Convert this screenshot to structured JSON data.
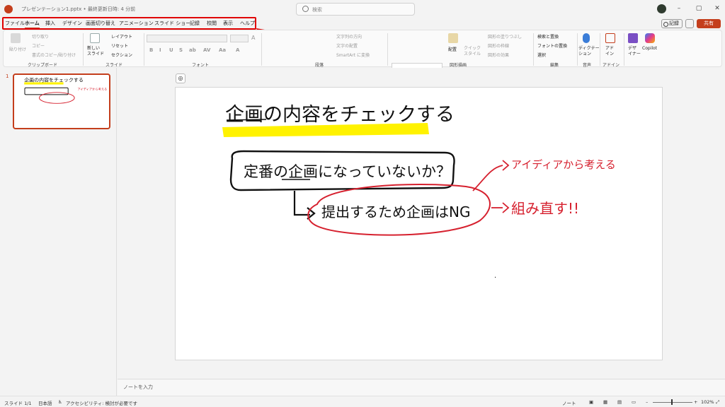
{
  "window": {
    "doc_title": "プレゼンテーション1.pptx • 最終更新日時: 4 分前",
    "search_placeholder": "検索"
  },
  "tabs": [
    "ファイル",
    "ホーム",
    "挿入",
    "デザイン",
    "画面切り替え",
    "アニメーション",
    "スライド ショー",
    "記録",
    "校閲",
    "表示",
    "ヘルプ"
  ],
  "active_tab": "ホーム",
  "header_actions": {
    "record": "記録",
    "share": "共有"
  },
  "ribbon": {
    "clipboard": {
      "paste": "貼り付け",
      "cut": "切り取り",
      "copy": "コピー",
      "format_painter": "書式のコピー/貼り付け",
      "label": "クリップボード"
    },
    "slides": {
      "new_slide": "新しい\nスライド",
      "layout": "レイアウト",
      "reset": "リセット",
      "section": "セクション",
      "label": "スライド"
    },
    "font": {
      "label": "フォント",
      "buttons": [
        "B",
        "I",
        "U",
        "S",
        "ab",
        "AV",
        "Aa",
        "A"
      ]
    },
    "paragraph": {
      "text_direction": "文字列の方向",
      "align_text": "文字の配置",
      "smartart": "SmartArt に変換",
      "label": "段落"
    },
    "drawing": {
      "arrange": "配置",
      "quick_styles": "クイック\nスタイル",
      "shape_fill": "図形の塗りつぶし",
      "shape_outline": "図形の枠線",
      "shape_effects": "図形の効果",
      "label": "図形描画"
    },
    "editing": {
      "find": "検索と置換",
      "replace_font": "フォントの置換",
      "select": "選択",
      "label": "編集"
    },
    "voice": {
      "dictate": "ディクテー\nション",
      "label": "音声"
    },
    "addins": {
      "addins": "アド\nイン",
      "label": "アドイン"
    },
    "designer": {
      "designer": "デザ\nイナー"
    },
    "copilot": {
      "copilot": "Copilot"
    }
  },
  "slide_panel": {
    "slide_number": "1"
  },
  "slide": {
    "title": "企画の内容をチェックする",
    "box_text": "定番の企画になっていないか？",
    "circle_text": "提出するため企画はNG",
    "note_right_1": "アイディアから考える",
    "note_right_2": "組み直す!!",
    "dot": "·"
  },
  "notes_placeholder": "ノートを入力",
  "status": {
    "slide_count": "スライド 1/1",
    "language": "日本語",
    "accessibility": "アクセシビリティ: 検討が必要です",
    "notes": "ノート",
    "zoom": "102%"
  },
  "colors": {
    "accent": "#c43e1c",
    "highlight": "#fff200",
    "pen_red": "#d6202e",
    "callout": "#e00000"
  }
}
